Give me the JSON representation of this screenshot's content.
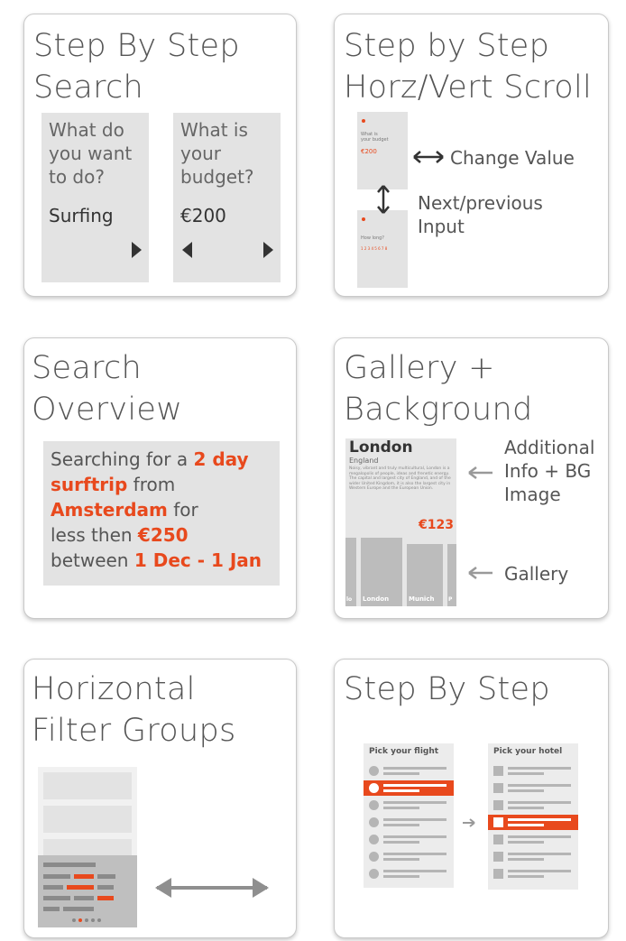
{
  "colors": {
    "accent": "#e8491d",
    "panel": "#e3e3e3",
    "text": "#555555"
  },
  "cards": {
    "c1": {
      "title": "Step By Step\nSearch",
      "step1": {
        "question": "What do\nyou want\nto do?",
        "answer": "Surfing"
      },
      "step2": {
        "question": "What is\nyour\nbudget?",
        "answer": "€200"
      }
    },
    "c2": {
      "title": "Step by Step\nHorz/Vert Scroll",
      "mini1": {
        "question": "What is\nyour budget",
        "value": "€200"
      },
      "mini2": {
        "question": "How long?",
        "value": "1 2 3 4 5 6 7 8"
      },
      "annot_change": "Change Value",
      "annot_next": "Next/previous\nInput"
    },
    "c3": {
      "title": "Search\nOverview",
      "text": {
        "p1": "Searching for a ",
        "h1": "2 day",
        "h2": "surftrip",
        "p2": " from",
        "h3": "Amsterdam",
        "p3": " for",
        "p4": "less then ",
        "h4": "€250",
        "p5": "between ",
        "h5": "1 Dec - 1 Jan"
      }
    },
    "c4": {
      "title": "Gallery +\nBackground",
      "city": "London",
      "country": "England",
      "desc": "Noisy, vibrant and truly multicultural, London is a megalopolis of people, ideas and frenetic energy. The capital and largest city of England, and of the wider United Kingdom, it is also the largest city in Western Europe and the European Union.",
      "price": "€123",
      "gallery": [
        "lo",
        "London",
        "Munich",
        "P"
      ],
      "annot_info": "Additional\nInfo + BG\nImage",
      "annot_gallery": "Gallery"
    },
    "c5": {
      "title": "Horizontal\nFilter Groups"
    },
    "c6": {
      "title": "Step By Step",
      "flight_head": "Pick your flight",
      "hotel_head": "Pick your hotel"
    }
  }
}
